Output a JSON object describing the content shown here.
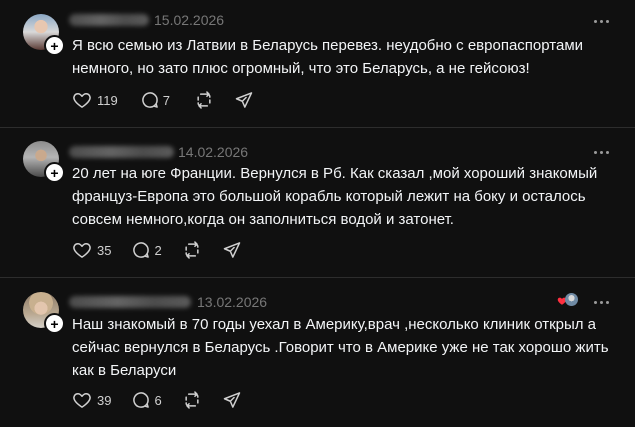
{
  "posts": [
    {
      "date": "15.02.2026",
      "text": "Я всю семью из Латвии в Беларусь перевез. неудобно с европаспортами немного, но зато плюс огромный, что это Беларусь, а не гейсоюз!",
      "likes": "119",
      "replies": "7"
    },
    {
      "date": "14.02.2026",
      "text": "20 лет на юге Франции. Вернулся в Рб. Как сказал ,мой хороший знакомый француз-Европа это большой корабль который лежит на боку и осталось совсем немного,когда он заполниться водой и затонет.",
      "likes": "35",
      "replies": "2"
    },
    {
      "date": "13.02.2026",
      "text": "Наш знакомый в 70 годы уехал в Америку,врач ,несколько клиник открыл а сейчас вернулся в Беларусь .Говорит что в Америке уже не так хорошо жить как в Беларуси",
      "likes": "39",
      "replies": "6"
    }
  ],
  "icons": {
    "like": "heart-icon",
    "reply": "comment-icon",
    "repost": "repost-icon",
    "share": "send-icon",
    "more": "more-icon",
    "follow": "plus-icon"
  },
  "colors": {
    "background": "#101010",
    "text": "#f3f5f7",
    "secondary": "#777777",
    "divider": "#2d2d2d",
    "liked_heart": "#ff3040"
  }
}
